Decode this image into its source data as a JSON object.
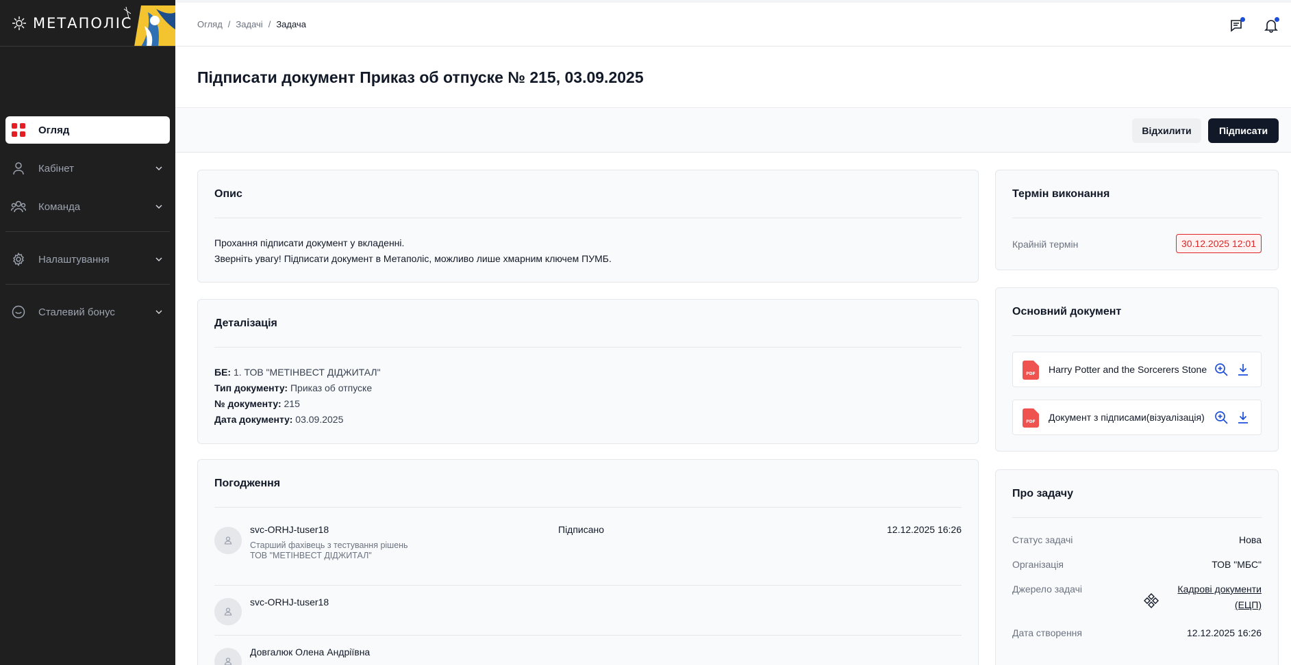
{
  "app": {
    "logo_text": "МЕТАПОЛІС"
  },
  "sidebar": {
    "items": [
      {
        "label": "Огляд",
        "icon": "grid-icon",
        "active": true
      },
      {
        "label": "Кабінет",
        "icon": "user-icon"
      },
      {
        "label": "Команда",
        "icon": "users-icon"
      },
      {
        "label": "Налаштування",
        "icon": "gear-icon"
      },
      {
        "label": "Сталевий бонус",
        "icon": "bonus-icon"
      }
    ]
  },
  "breadcrumb": [
    "Огляд",
    "Задачі",
    "Задача"
  ],
  "header": {
    "title": "Підписати документ Приказ об отпуске № 215, 03.09.2025"
  },
  "actions": {
    "reject": "Відхилити",
    "sign": "Підписати"
  },
  "description": {
    "title": "Опис",
    "line1": "Прохання підписати документ у вкладенні.",
    "line2": "Зверніть увагу! Підписати документ в Метаполіс, можливо лише хмарним ключем ПУМБ."
  },
  "details": {
    "title": "Деталізація",
    "rows": [
      {
        "label": "БЕ:",
        "value": "1. ТОВ \"МЕТІНВЕСТ ДІДЖИТАЛ\""
      },
      {
        "label": "Тип документу:",
        "value": "Приказ об отпуске"
      },
      {
        "label": "№ документу:",
        "value": "215"
      },
      {
        "label": "Дата документу:",
        "value": "03.09.2025"
      }
    ]
  },
  "approvals": {
    "title": "Погодження",
    "rows": [
      {
        "name": "svc-ORHJ-tuser18",
        "position": "Старший фахівець з тестування рішень",
        "org": "ТОВ \"МЕТІНВЕСТ ДІДЖИТАЛ\"",
        "status": "Підписано",
        "date": "12.12.2025 16:26"
      },
      {
        "name": "svc-ORHJ-tuser18",
        "position": "",
        "org": "",
        "status": "",
        "date": ""
      },
      {
        "name": "Довгалюк Олена Андріївна",
        "position": "",
        "org": "",
        "status": "",
        "date": ""
      }
    ]
  },
  "deadline": {
    "title": "Термін виконання",
    "label": "Крайній термін",
    "value": "30.12.2025 12:01",
    "color": "#dc2626"
  },
  "main_document": {
    "title": "Основний документ",
    "files": [
      {
        "name": "Harry Potter and the Sorcerers Stone",
        "type": "PDF"
      },
      {
        "name": "Документ з підписами(візуалізація)",
        "type": "PDF"
      }
    ]
  },
  "about": {
    "title": "Про задачу",
    "status_label": "Статус задачі",
    "status_value": "Нова",
    "org_label": "Організація",
    "org_value": "ТОВ \"МБС\"",
    "source_label": "Джерело задачі",
    "source_line1": "Кадрові документи",
    "source_line2": "(ЕЦП)",
    "created_label": "Дата створення",
    "created_value": "12.12.2025 16:26"
  },
  "colors": {
    "accent": "#111827",
    "brand_red": "#e31e24",
    "notify_dot": "#1d4ed8"
  }
}
